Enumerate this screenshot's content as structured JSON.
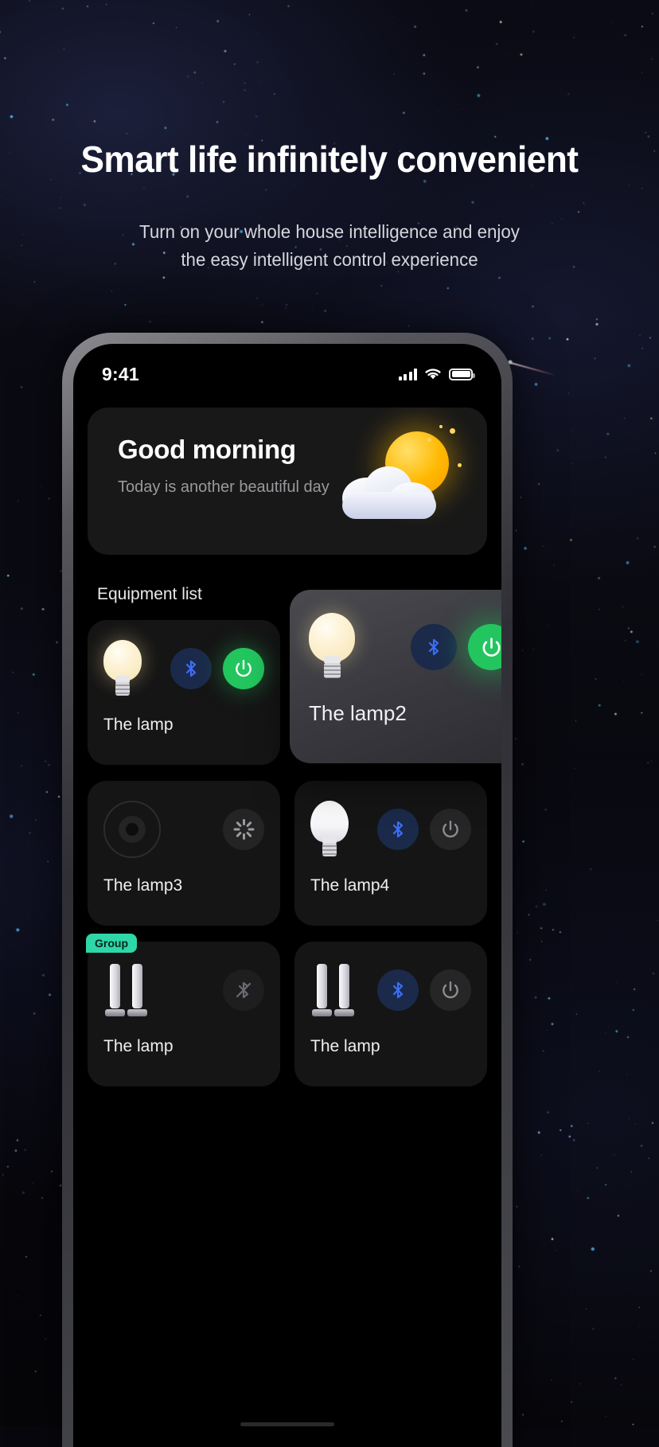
{
  "hero": {
    "title": "Smart life infinitely convenient",
    "subtitle_line1": "Turn on your whole house intelligence and enjoy",
    "subtitle_line2": "the easy intelligent control experience"
  },
  "phone": {
    "statusbar": {
      "time": "9:41",
      "signal_icon": "cellular-signal-icon",
      "wifi_icon": "wifi-icon",
      "battery_icon": "battery-full-icon"
    },
    "greeting": {
      "title": "Good morning",
      "subtitle": "Today is another beautiful day",
      "weather_icon": "sun-behind-cloud-icon"
    },
    "section_label": "Equipment list",
    "devices": [
      {
        "name": "The lamp",
        "device_icon": "light-bulb-on-icon",
        "bluetooth_icon": "bluetooth-icon",
        "bluetooth_state": "connected",
        "power_icon": "power-icon",
        "power_state": "on",
        "badge": "",
        "selected": false
      },
      {
        "name": "The lamp2",
        "device_icon": "light-bulb-on-icon",
        "bluetooth_icon": "bluetooth-icon",
        "bluetooth_state": "connected",
        "power_icon": "power-icon",
        "power_state": "on",
        "badge": "",
        "selected": true
      },
      {
        "name": "The lamp3",
        "device_icon": "ring-light-off-icon",
        "bluetooth_icon": "",
        "bluetooth_state": "none",
        "power_icon": "loading-spinner-icon",
        "power_state": "loading",
        "badge": "",
        "selected": false
      },
      {
        "name": "The lamp4",
        "device_icon": "light-bulb-cone-icon",
        "bluetooth_icon": "bluetooth-icon",
        "bluetooth_state": "connected",
        "power_icon": "power-icon",
        "power_state": "off",
        "badge": "",
        "selected": false
      },
      {
        "name": "The lamp",
        "device_icon": "tube-lamp-icon",
        "bluetooth_icon": "bluetooth-off-icon",
        "bluetooth_state": "disconnected",
        "power_icon": "",
        "power_state": "none",
        "badge": "Group",
        "selected": false
      },
      {
        "name": "The lamp",
        "device_icon": "tube-lamp-icon",
        "bluetooth_icon": "bluetooth-icon",
        "bluetooth_state": "connected",
        "power_icon": "power-icon",
        "power_state": "off",
        "badge": "",
        "selected": false
      }
    ]
  },
  "colors": {
    "accent_green": "#22c55e",
    "bluetooth_blue": "#3b6ef6",
    "group_badge": "#2fd6a8",
    "card_bg": "#151515",
    "screen_bg": "#000000"
  }
}
